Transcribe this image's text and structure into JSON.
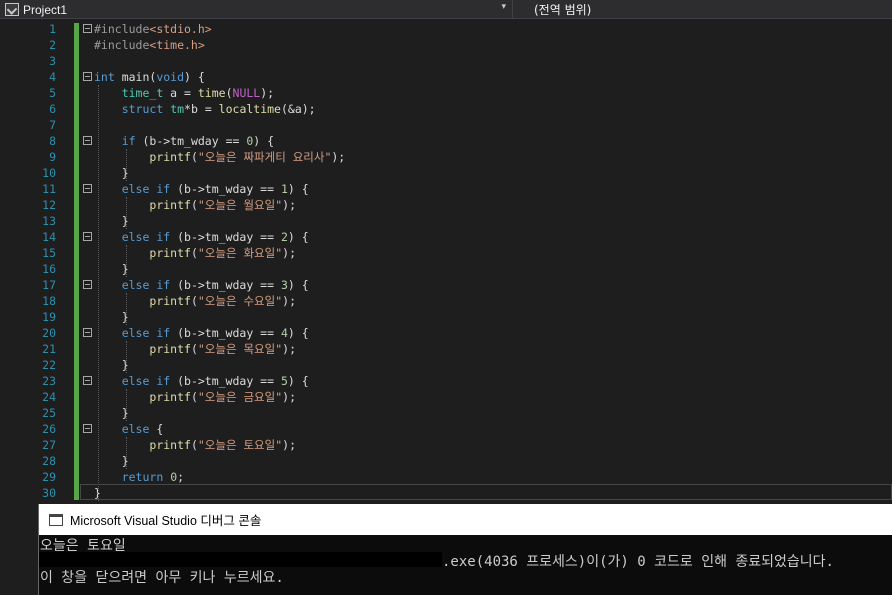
{
  "navbar": {
    "project": "Project1",
    "scope": "(전역 범위)",
    "dropdown_glyph": "▾"
  },
  "editor": {
    "line_numbers": [
      "1",
      "2",
      "3",
      "4",
      "5",
      "6",
      "7",
      "8",
      "9",
      "10",
      "11",
      "12",
      "13",
      "14",
      "15",
      "16",
      "17",
      "18",
      "19",
      "20",
      "21",
      "22",
      "23",
      "24",
      "25",
      "26",
      "27",
      "28",
      "29",
      "30"
    ],
    "lines": [
      [
        {
          "t": "#include",
          "c": "pp"
        },
        {
          "t": "<stdio.h>",
          "c": "str"
        }
      ],
      [
        {
          "t": "#include",
          "c": "pp"
        },
        {
          "t": "<time.h>",
          "c": "str"
        }
      ],
      [],
      [
        {
          "t": "int",
          "c": "kw"
        },
        {
          "t": " main("
        },
        {
          "t": "void",
          "c": "kw"
        },
        {
          "t": ") {"
        }
      ],
      [
        {
          "t": "    "
        },
        {
          "t": "time_t",
          "c": "ty"
        },
        {
          "t": " a = "
        },
        {
          "t": "time",
          "c": "fn"
        },
        {
          "t": "("
        },
        {
          "t": "NULL",
          "c": "mac"
        },
        {
          "t": ");"
        }
      ],
      [
        {
          "t": "    "
        },
        {
          "t": "struct",
          "c": "kw"
        },
        {
          "t": " "
        },
        {
          "t": "tm",
          "c": "ty"
        },
        {
          "t": "*b = "
        },
        {
          "t": "localtime",
          "c": "fn"
        },
        {
          "t": "(&a);"
        }
      ],
      [],
      [
        {
          "t": "    "
        },
        {
          "t": "if",
          "c": "kw"
        },
        {
          "t": " (b->tm_wday == "
        },
        {
          "t": "0",
          "c": "num"
        },
        {
          "t": ") {"
        }
      ],
      [
        {
          "t": "        "
        },
        {
          "t": "printf",
          "c": "fn"
        },
        {
          "t": "("
        },
        {
          "t": "\"오늘은 짜파게티 요리사\"",
          "c": "str"
        },
        {
          "t": ");"
        }
      ],
      [
        {
          "t": "    }"
        }
      ],
      [
        {
          "t": "    "
        },
        {
          "t": "else if",
          "c": "kw"
        },
        {
          "t": " (b->tm_wday == "
        },
        {
          "t": "1",
          "c": "num"
        },
        {
          "t": ") {"
        }
      ],
      [
        {
          "t": "        "
        },
        {
          "t": "printf",
          "c": "fn"
        },
        {
          "t": "("
        },
        {
          "t": "\"오늘은 월요일\"",
          "c": "str"
        },
        {
          "t": ");"
        }
      ],
      [
        {
          "t": "    }"
        }
      ],
      [
        {
          "t": "    "
        },
        {
          "t": "else if",
          "c": "kw"
        },
        {
          "t": " (b->tm_wday == "
        },
        {
          "t": "2",
          "c": "num"
        },
        {
          "t": ") {"
        }
      ],
      [
        {
          "t": "        "
        },
        {
          "t": "printf",
          "c": "fn"
        },
        {
          "t": "("
        },
        {
          "t": "\"오늘은 화요일\"",
          "c": "str"
        },
        {
          "t": ");"
        }
      ],
      [
        {
          "t": "    }"
        }
      ],
      [
        {
          "t": "    "
        },
        {
          "t": "else if",
          "c": "kw"
        },
        {
          "t": " (b->tm_wday == "
        },
        {
          "t": "3",
          "c": "num"
        },
        {
          "t": ") {"
        }
      ],
      [
        {
          "t": "        "
        },
        {
          "t": "printf",
          "c": "fn"
        },
        {
          "t": "("
        },
        {
          "t": "\"오늘은 수요일\"",
          "c": "str"
        },
        {
          "t": ");"
        }
      ],
      [
        {
          "t": "    }"
        }
      ],
      [
        {
          "t": "    "
        },
        {
          "t": "else if",
          "c": "kw"
        },
        {
          "t": " (b->tm_wday == "
        },
        {
          "t": "4",
          "c": "num"
        },
        {
          "t": ") {"
        }
      ],
      [
        {
          "t": "        "
        },
        {
          "t": "printf",
          "c": "fn"
        },
        {
          "t": "("
        },
        {
          "t": "\"오늘은 목요일\"",
          "c": "str"
        },
        {
          "t": ");"
        }
      ],
      [
        {
          "t": "    }"
        }
      ],
      [
        {
          "t": "    "
        },
        {
          "t": "else if",
          "c": "kw"
        },
        {
          "t": " (b->tm_wday == "
        },
        {
          "t": "5",
          "c": "num"
        },
        {
          "t": ") {"
        }
      ],
      [
        {
          "t": "        "
        },
        {
          "t": "printf",
          "c": "fn"
        },
        {
          "t": "("
        },
        {
          "t": "\"오늘은 금요일\"",
          "c": "str"
        },
        {
          "t": ");"
        }
      ],
      [
        {
          "t": "    }"
        }
      ],
      [
        {
          "t": "    "
        },
        {
          "t": "else",
          "c": "kw"
        },
        {
          "t": " {"
        }
      ],
      [
        {
          "t": "        "
        },
        {
          "t": "printf",
          "c": "fn"
        },
        {
          "t": "("
        },
        {
          "t": "\"오늘은 토요일\"",
          "c": "str"
        },
        {
          "t": ");"
        }
      ],
      [
        {
          "t": "    }"
        }
      ],
      [
        {
          "t": "    "
        },
        {
          "t": "return",
          "c": "kw"
        },
        {
          "t": " "
        },
        {
          "t": "0",
          "c": "num"
        },
        {
          "t": ";"
        }
      ],
      [
        {
          "t": "}"
        }
      ]
    ],
    "fold_lines": [
      1,
      4,
      8,
      11,
      14,
      17,
      20,
      23,
      26
    ],
    "colors": {
      "keyword": "#569cd6",
      "string": "#d69d85",
      "preprocessor": "#9b9b9b",
      "type": "#4ec9b0",
      "function": "#dcdcaa",
      "macro": "#bd63c5",
      "number": "#b5cea8",
      "line_number": "#2b91af",
      "change_bar": "#57a64a"
    }
  },
  "console": {
    "title": "Microsoft Visual Studio 디버그 콘솔",
    "output_lines": [
      "오늘은 토요일",
      ".exe(4036 프로세스)이(가) 0 코드로 인해 종료되었습니다.",
      "이 창을 닫으려면 아무 키나 누르세요."
    ]
  }
}
